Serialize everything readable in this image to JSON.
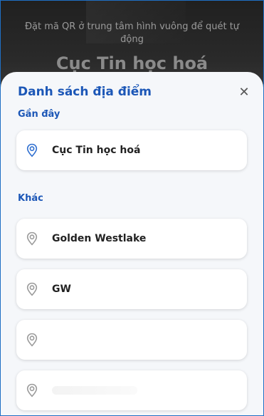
{
  "scanner": {
    "hint": "Đặt mã QR ở trung tâm hình vuông để quét tự động",
    "background_place": "Cục Tin học hoá"
  },
  "sheet": {
    "title": "Danh sách địa điểm",
    "close_icon": "close-icon",
    "recent_label": "Gần đây",
    "other_label": "Khác",
    "recent": [
      {
        "name": "Cục Tin học hoá",
        "icon": "location-pin-icon"
      }
    ],
    "others": [
      {
        "name": "Golden Westlake",
        "icon": "location-pin-icon"
      },
      {
        "name": "GW",
        "icon": "location-pin-icon"
      },
      {
        "name": "",
        "icon": "location-pin-icon"
      },
      {
        "name": "",
        "icon": "location-pin-icon"
      }
    ]
  },
  "colors": {
    "accent": "#1c57b7",
    "pin": "#2f6fd0",
    "pin_muted": "#9a9a9a"
  }
}
